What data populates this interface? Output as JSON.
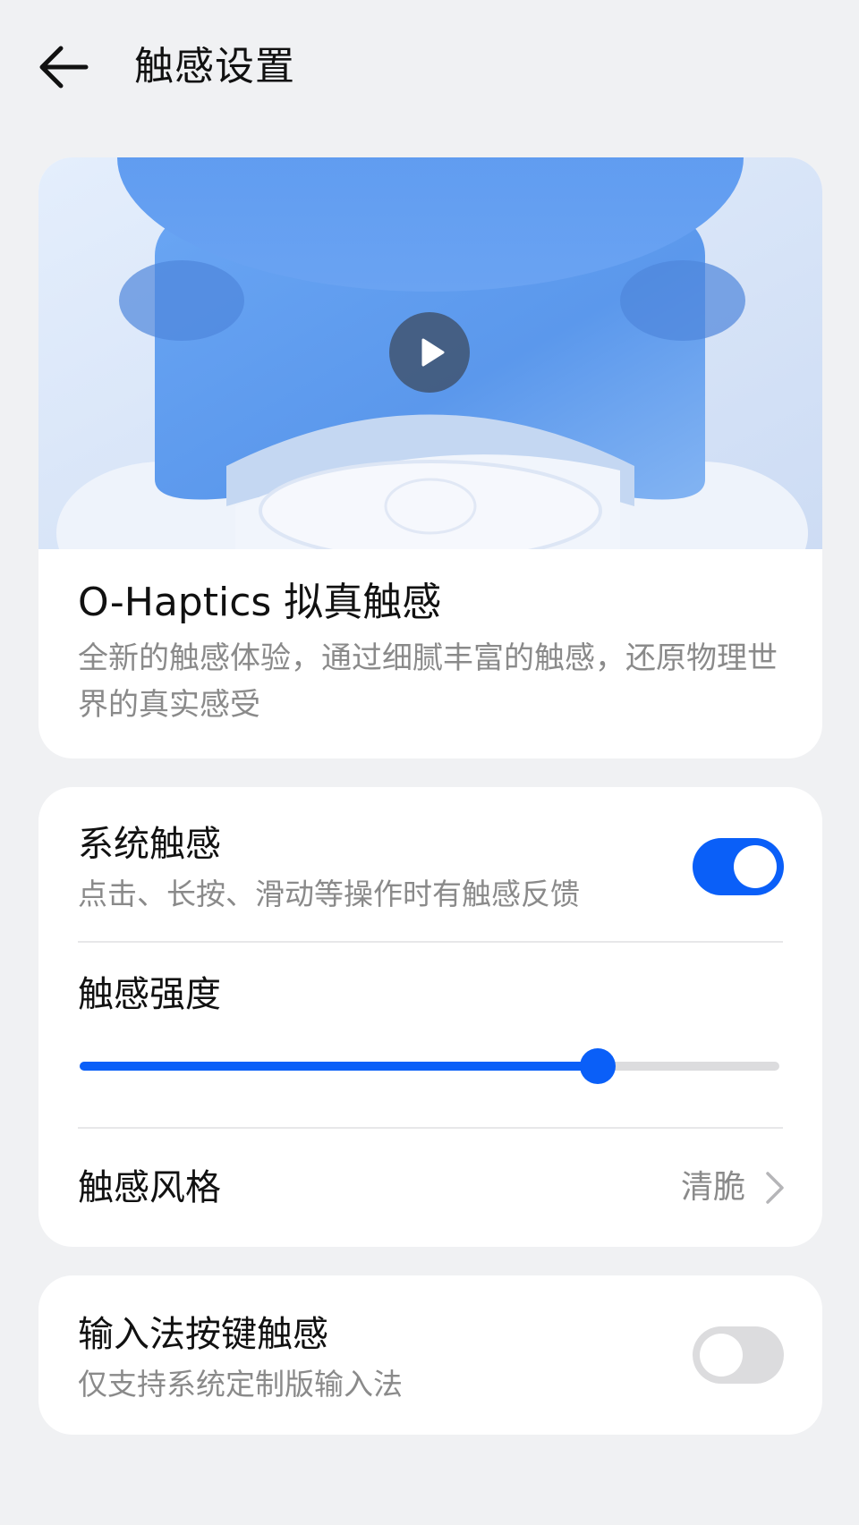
{
  "header": {
    "title": "触感设置"
  },
  "hero": {
    "title": "O-Haptics 拟真触感",
    "description": "全新的触感体验，通过细腻丰富的触感，还原物理世界的真实感受"
  },
  "system_haptics": {
    "label": "系统触感",
    "subtitle": "点击、长按、滑动等操作时有触感反馈",
    "enabled": true
  },
  "intensity": {
    "label": "触感强度",
    "value_fraction": 0.74
  },
  "style": {
    "label": "触感风格",
    "value": "清脆"
  },
  "input_method": {
    "label": "输入法按键触感",
    "subtitle": "仅支持系统定制版输入法",
    "enabled": false
  },
  "colors": {
    "accent": "#0a5ff8",
    "background": "#f0f1f3",
    "secondary_text": "#8a8a8a"
  }
}
